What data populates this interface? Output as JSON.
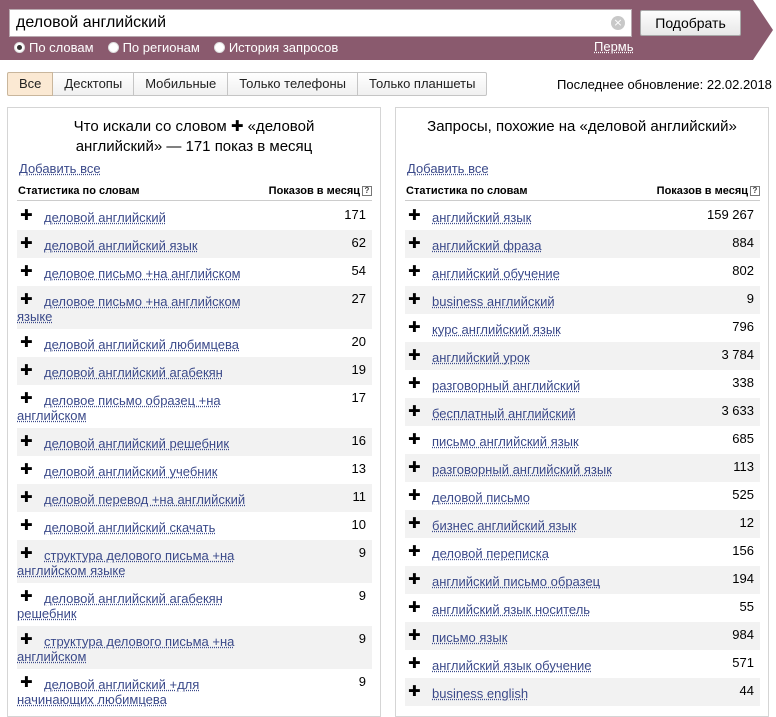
{
  "search": {
    "query": "деловой английский",
    "submit_label": "Подобрать",
    "modes": [
      {
        "label": "По словам",
        "checked": true
      },
      {
        "label": "По регионам",
        "checked": false
      },
      {
        "label": "История запросов",
        "checked": false
      }
    ],
    "region": "Пермь",
    "clear_icon": "×"
  },
  "tabs": [
    {
      "label": "Все",
      "active": true
    },
    {
      "label": "Десктопы",
      "active": false
    },
    {
      "label": "Мобильные",
      "active": false
    },
    {
      "label": "Только телефоны",
      "active": false
    },
    {
      "label": "Только планшеты",
      "active": false
    }
  ],
  "update_info": "Последнее обновление: 22.02.2018",
  "left_panel": {
    "title_line1": "Что искали со словом ✚ «деловой",
    "title_line2": "английский» — 171 показ в месяц",
    "add_all": "Добавить все",
    "col_keywords": "Статистика по словам",
    "col_count": "Показов в месяц",
    "rows": [
      {
        "keyword": "деловой английский",
        "count": "171",
        "lines": 1
      },
      {
        "keyword": "деловой английский язык",
        "count": "62",
        "lines": 1
      },
      {
        "keyword": "деловое письмо +на английском",
        "count": "54",
        "lines": 1
      },
      {
        "keyword": "деловое письмо +на английском языке",
        "count": "27",
        "lines": 2
      },
      {
        "keyword": "деловой английский любимцева",
        "count": "20",
        "lines": 1
      },
      {
        "keyword": "деловой английский агабекян",
        "count": "19",
        "lines": 1
      },
      {
        "keyword": "деловое письмо образец +на английском",
        "count": "17",
        "lines": 2
      },
      {
        "keyword": "деловой английский решебник",
        "count": "16",
        "lines": 1
      },
      {
        "keyword": "деловой английский учебник",
        "count": "13",
        "lines": 1
      },
      {
        "keyword": "деловой перевод +на английский",
        "count": "11",
        "lines": 1
      },
      {
        "keyword": "деловой английский скачать",
        "count": "10",
        "lines": 1
      },
      {
        "keyword": "структура делового письма +на английском языке",
        "count": "9",
        "lines": 2
      },
      {
        "keyword": "деловой английский агабекян решебник",
        "count": "9",
        "lines": 2
      },
      {
        "keyword": "структура делового письма +на английском",
        "count": "9",
        "lines": 2
      },
      {
        "keyword": "деловой английский +для начинающих любимцева",
        "count": "9",
        "lines": 2
      }
    ]
  },
  "right_panel": {
    "title": "Запросы, похожие на «деловой английский»",
    "add_all": "Добавить все",
    "col_keywords": "Статистика по словам",
    "col_count": "Показов в месяц",
    "rows": [
      {
        "keyword": "английский язык",
        "count": "159 267",
        "lines": 1
      },
      {
        "keyword": "английский фраза",
        "count": "884",
        "lines": 1
      },
      {
        "keyword": "английский обучение",
        "count": "802",
        "lines": 1
      },
      {
        "keyword": "business английский",
        "count": "9",
        "lines": 1
      },
      {
        "keyword": "курс английский язык",
        "count": "796",
        "lines": 1
      },
      {
        "keyword": "английский урок",
        "count": "3 784",
        "lines": 1
      },
      {
        "keyword": "разговорный английский",
        "count": "338",
        "lines": 1
      },
      {
        "keyword": "бесплатный английский",
        "count": "3 633",
        "lines": 1
      },
      {
        "keyword": "письмо английский язык",
        "count": "685",
        "lines": 1
      },
      {
        "keyword": "разговорный английский язык",
        "count": "113",
        "lines": 1
      },
      {
        "keyword": "деловой письмо",
        "count": "525",
        "lines": 1
      },
      {
        "keyword": "бизнес английский язык",
        "count": "12",
        "lines": 1
      },
      {
        "keyword": "деловой переписка",
        "count": "156",
        "lines": 1
      },
      {
        "keyword": "английский письмо образец",
        "count": "194",
        "lines": 1
      },
      {
        "keyword": "английский язык носитель",
        "count": "55",
        "lines": 1
      },
      {
        "keyword": "письмо язык",
        "count": "984",
        "lines": 1
      },
      {
        "keyword": "английский язык обучение",
        "count": "571",
        "lines": 1
      },
      {
        "keyword": "business english",
        "count": "44",
        "lines": 1
      }
    ]
  }
}
